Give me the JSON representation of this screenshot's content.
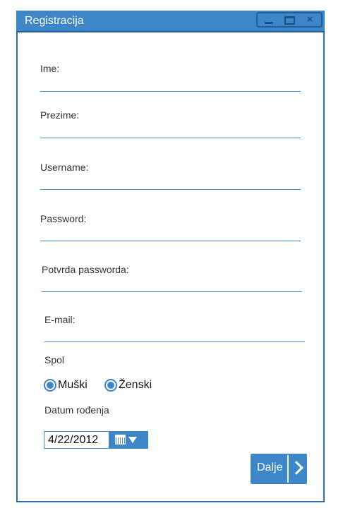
{
  "window": {
    "title": "Registracija",
    "controls": {
      "minimize": "minimize-icon",
      "maximize": "maximize-icon",
      "close": "×"
    }
  },
  "form": {
    "fields": [
      {
        "label": "Ime:",
        "value": ""
      },
      {
        "label": "Prezime:",
        "value": ""
      },
      {
        "label": "Username:",
        "value": ""
      },
      {
        "label": "Password:",
        "value": ""
      },
      {
        "label": "Potvrda passworda:",
        "value": ""
      },
      {
        "label": "E-mail:",
        "value": ""
      }
    ],
    "gender": {
      "label": "Spol",
      "options": [
        {
          "label": "Muški",
          "selected": true
        },
        {
          "label": "Ženski",
          "selected": true
        }
      ]
    },
    "birthdate": {
      "label": "Datum rođenja",
      "value": "4/22/2012",
      "picker_icon": "calendar-icon"
    },
    "next_button": {
      "label": "Dalje",
      "icon": "chevron-right-icon"
    }
  },
  "colors": {
    "accent": "#3d86c8",
    "border": "#2f6fae"
  }
}
